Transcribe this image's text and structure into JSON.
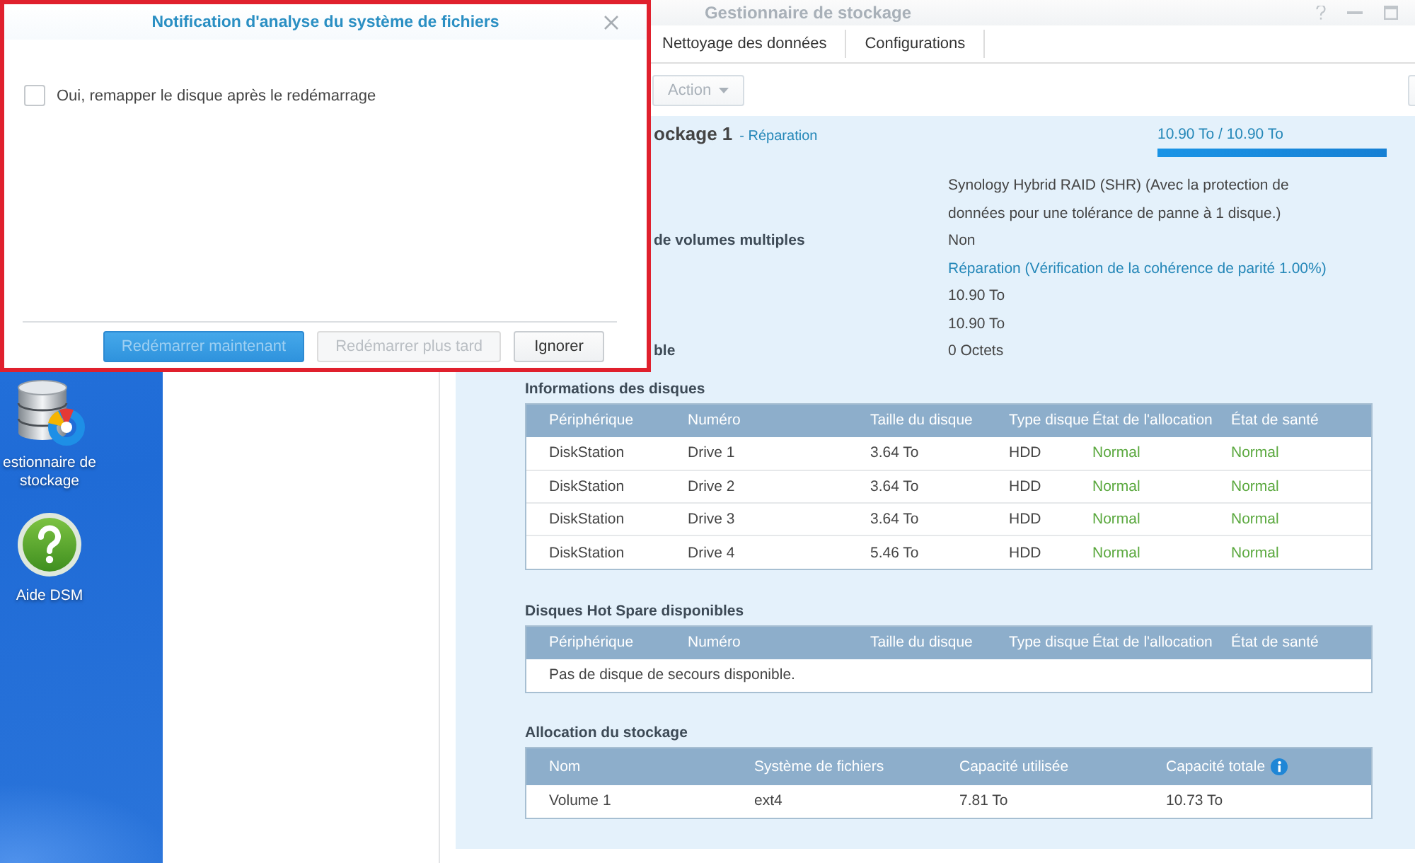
{
  "dialog": {
    "title": "Notification d'analyse du système de fichiers",
    "checkbox": {
      "label": "Oui, remapper le disque après le redémarrage",
      "checked": false
    },
    "buttons": [
      {
        "label": "Redémarrer maintenant",
        "kind": "primary",
        "disabled": true
      },
      {
        "label": "Redémarrer plus tard",
        "kind": "default",
        "disabled": true
      },
      {
        "label": "Ignorer",
        "kind": "default",
        "disabled": false
      }
    ]
  },
  "desktop": {
    "icons": [
      {
        "kind": "storage",
        "label": "estionnaire de stockage"
      },
      {
        "kind": "help",
        "label": "Aide DSM"
      }
    ]
  },
  "window": {
    "title": "Gestionnaire de stockage",
    "tabs": [
      {
        "label": "Nettoyage des données",
        "selected": false
      },
      {
        "label": "Configurations",
        "selected": false
      }
    ],
    "toolbar": {
      "action": {
        "label": "Action",
        "disabled": true
      }
    }
  },
  "pool": {
    "name": "ockage 1",
    "status": "- Réparation",
    "usage": "10.90 To / 10.90 To",
    "level": 1,
    "info": [
      {
        "kind": "plain",
        "value": "Synology Hybrid RAID (SHR) (Avec la protection de données pour une tolérance de panne à 1 disque.)"
      },
      {
        "kind": "plain",
        "label": "de volumes multiples",
        "value": "Non"
      },
      {
        "kind": "status",
        "value": "Réparation (Vérification de la cohérence de parité 1.00%)"
      },
      {
        "kind": "plain",
        "value": "10.90 To"
      },
      {
        "kind": "plain",
        "value": "10.90 To"
      },
      {
        "kind": "plain",
        "label": "ble",
        "value": "0 Octets"
      }
    ]
  },
  "disks": {
    "title": "Informations des disques",
    "columns": [
      "Périphérique",
      "Numéro",
      "Taille du disque",
      "Type disque",
      "État de l'allocation",
      "État de santé"
    ],
    "rows": [
      {
        "device": "DiskStation",
        "number": "Drive 1",
        "size": "3.64 To",
        "type": "HDD",
        "allocation": "Normal",
        "health": "Normal"
      },
      {
        "device": "DiskStation",
        "number": "Drive 2",
        "size": "3.64 To",
        "type": "HDD",
        "allocation": "Normal",
        "health": "Normal"
      },
      {
        "device": "DiskStation",
        "number": "Drive 3",
        "size": "3.64 To",
        "type": "HDD",
        "allocation": "Normal",
        "health": "Normal"
      },
      {
        "device": "DiskStation",
        "number": "Drive 4",
        "size": "5.46 To",
        "type": "HDD",
        "allocation": "Normal",
        "health": "Normal"
      }
    ]
  },
  "hot_spare": {
    "title": "Disques Hot Spare disponibles",
    "columns": [
      "Périphérique",
      "Numéro",
      "Taille du disque",
      "Type disque",
      "État de l'allocation",
      "État de santé"
    ],
    "empty_message": "Pas de disque de secours disponible."
  },
  "allocation": {
    "title": "Allocation du stockage",
    "columns": [
      {
        "label": "Nom",
        "info": false
      },
      {
        "label": "Système de fichiers",
        "info": false
      },
      {
        "label": "Capacité utilisée",
        "info": false
      },
      {
        "label": "Capacité totale",
        "info": true
      }
    ],
    "rows": [
      [
        "Volume 1",
        "ext4",
        "7.81 To",
        "10.73 To"
      ]
    ]
  }
}
